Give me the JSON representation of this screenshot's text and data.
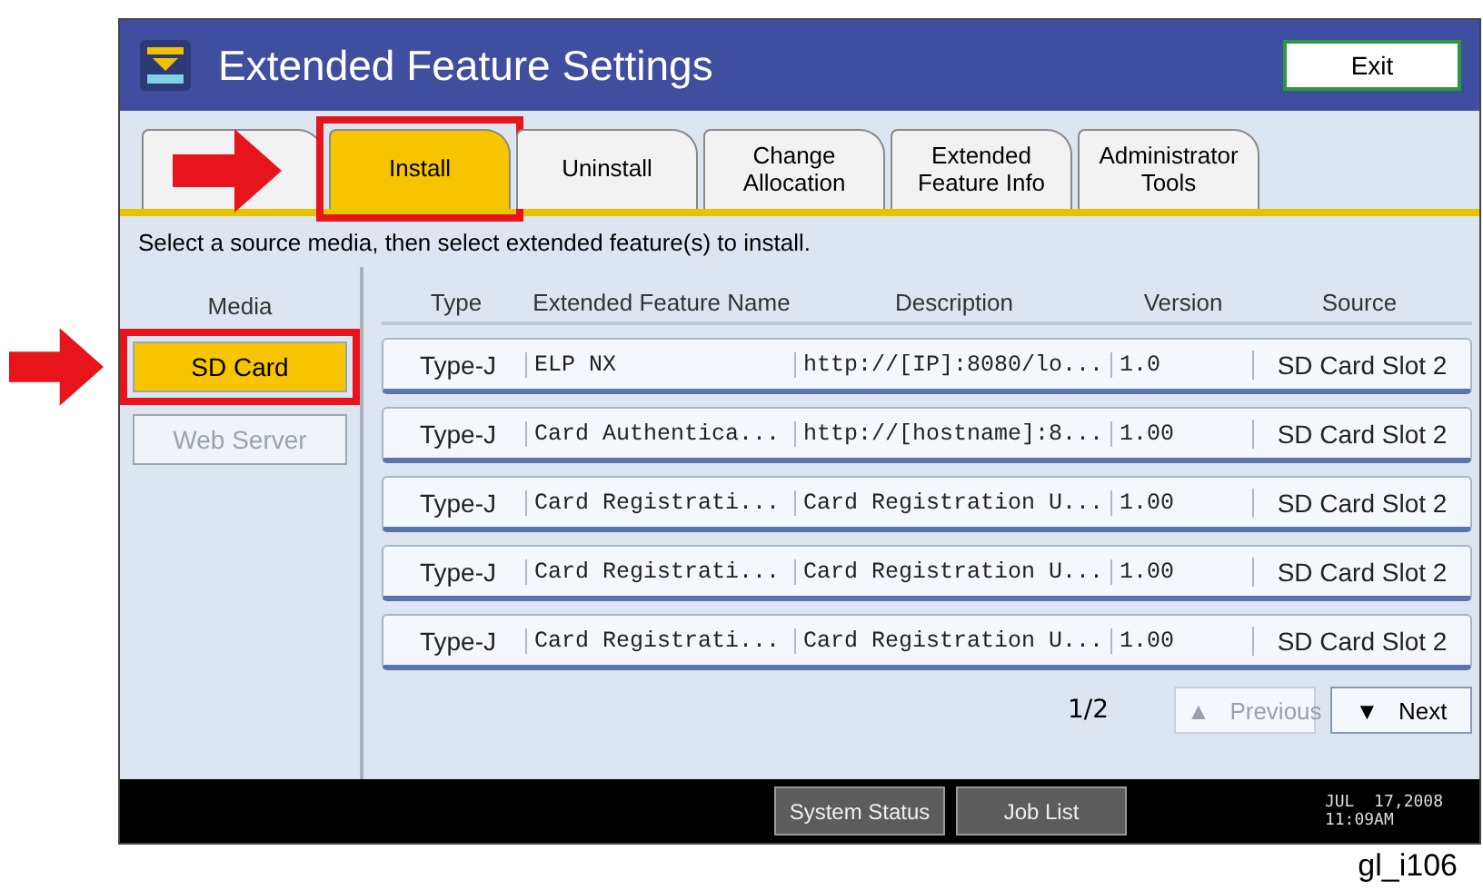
{
  "window": {
    "title": "Extended Feature Settings",
    "exit_button": "Exit"
  },
  "tabs": [
    {
      "selected": false,
      "callout": false
    },
    {
      "label": "Install",
      "selected": true,
      "callout": true
    },
    {
      "label": "Uninstall",
      "selected": false,
      "callout": false
    },
    {
      "label": "Change\nAllocation",
      "selected": false,
      "callout": false
    },
    {
      "label": "Extended\nFeature Info",
      "selected": false,
      "callout": false
    },
    {
      "label": "Administrator\nTools",
      "selected": false,
      "callout": false
    }
  ],
  "instruction": "Select a source media, then select extended feature(s) to install.",
  "media": {
    "heading": "Media",
    "items": [
      {
        "label": "SD Card",
        "selected": true,
        "disabled": false,
        "callout": true
      },
      {
        "label": "Web Server",
        "selected": false,
        "disabled": true,
        "callout": false
      }
    ]
  },
  "table": {
    "columns": [
      "Type",
      "Extended Feature Name",
      "Description",
      "Version",
      "Source"
    ],
    "rows": [
      [
        "Type-J",
        "ELP NX",
        "http://[IP]:8080/lo...",
        "1.0",
        "SD Card Slot 2"
      ],
      [
        "Type-J",
        "Card Authentica...",
        "http://[hostname]:8...",
        "1.00",
        "SD Card Slot 2"
      ],
      [
        "Type-J",
        "Card Registrati...",
        "Card Registration U...",
        "1.00",
        "SD Card Slot 2"
      ],
      [
        "Type-J",
        "Card Registrati...",
        "Card Registration U...",
        "1.00",
        "SD Card Slot 2"
      ],
      [
        "Type-J",
        "Card Registrati...",
        "Card Registration U...",
        "1.00",
        "SD Card Slot 2"
      ]
    ]
  },
  "pager": {
    "page": "1/2",
    "buttons": [
      {
        "icon": "▲",
        "label": "Previous",
        "disabled": true
      },
      {
        "icon": "▼",
        "label": "Next",
        "disabled": false
      }
    ]
  },
  "status_bar": {
    "buttons": [
      "System Status",
      "Job List"
    ],
    "date": "JUL  17,2008",
    "time": "11:09AM"
  },
  "figure_label": "gl_i106"
}
